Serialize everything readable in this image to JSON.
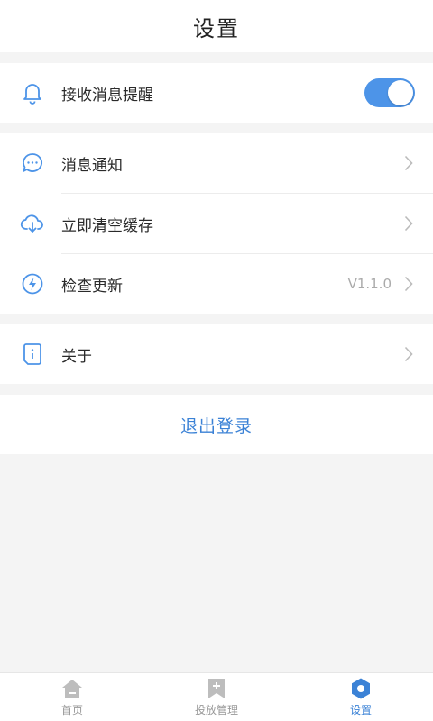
{
  "header": {
    "title": "设置"
  },
  "group1": {
    "notify_label": "接收消息提醒",
    "toggle_on": true
  },
  "group2": {
    "items": [
      {
        "label": "消息通知",
        "icon": "chat-icon"
      },
      {
        "label": "立即清空缓存",
        "icon": "cloud-download-icon"
      },
      {
        "label": "检查更新",
        "icon": "lightning-icon",
        "value": "V1.1.0"
      }
    ]
  },
  "group3": {
    "about_label": "关于",
    "icon": "info-icon"
  },
  "logout": {
    "label": "退出登录"
  },
  "tabbar": {
    "tabs": [
      {
        "label": "首页",
        "icon": "home-icon"
      },
      {
        "label": "投放管理",
        "icon": "bookmark-plus-icon"
      },
      {
        "label": "设置",
        "icon": "settings-hex-icon",
        "active": true
      }
    ]
  },
  "colors": {
    "accent": "#3b82d6",
    "toggle": "#4d94e8",
    "background": "#f4f4f4"
  }
}
